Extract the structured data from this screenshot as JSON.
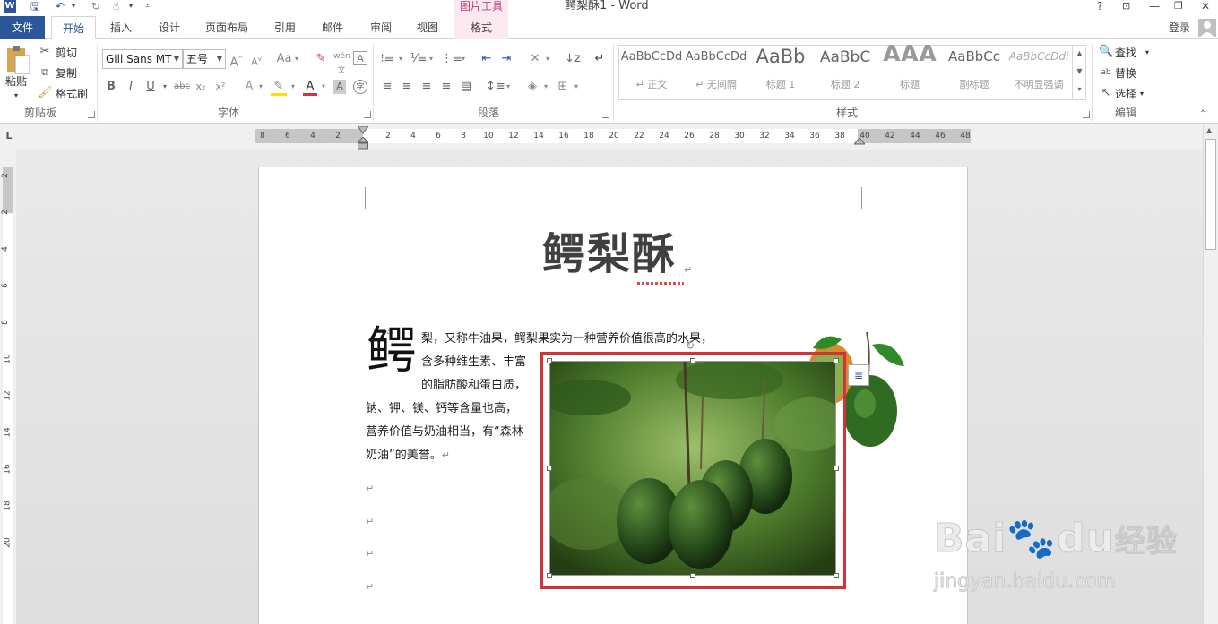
{
  "window": {
    "title": "鳄梨酥1 - Word",
    "help": "?",
    "login": "登录"
  },
  "picture_tools": {
    "label": "图片工具",
    "tab": "格式"
  },
  "tabs": [
    {
      "label": "文件"
    },
    {
      "label": "开始"
    },
    {
      "label": "插入"
    },
    {
      "label": "设计"
    },
    {
      "label": "页面布局"
    },
    {
      "label": "引用"
    },
    {
      "label": "邮件"
    },
    {
      "label": "审阅"
    },
    {
      "label": "视图"
    }
  ],
  "clipboard": {
    "paste": "粘贴",
    "cut": "剪切",
    "copy": "复制",
    "format_painter": "格式刷",
    "group": "剪贴板"
  },
  "font": {
    "name": "Gill Sans MT",
    "size": "五号",
    "group": "字体",
    "change_case": "Aa",
    "phonetic": "wén",
    "bold": "B",
    "italic": "I",
    "underline": "U",
    "strike": "abc",
    "subscript": "x₂",
    "superscript": "x²",
    "grow": "A",
    "shrink": "A",
    "font_color": "A",
    "effects": "A",
    "char_shading": "A",
    "enclose": "字",
    "border": "A"
  },
  "paragraph": {
    "group": "段落"
  },
  "styles": {
    "group": "样式",
    "items": [
      {
        "preview": "AaBbCcDd",
        "name": "↵ 正文"
      },
      {
        "preview": "AaBbCcDd",
        "name": "↵ 无间隔"
      },
      {
        "preview": "AaBb",
        "name": "标题 1"
      },
      {
        "preview": "AaBbC",
        "name": "标题 2"
      },
      {
        "preview": "AAA",
        "name": "标题"
      },
      {
        "preview": "AaBbCc",
        "name": "副标题"
      },
      {
        "preview": "AaBbCcDdi",
        "name": "不明显强调"
      }
    ]
  },
  "editing": {
    "group": "编辑",
    "find": "查找",
    "replace": "替换",
    "select": "选择"
  },
  "ruler": {
    "corner": "L",
    "left_ticks": [
      "8",
      "6",
      "4",
      "2"
    ],
    "ticks": [
      "2",
      "4",
      "6",
      "8",
      "10",
      "12",
      "14",
      "16",
      "18",
      "20",
      "22",
      "24",
      "26",
      "28",
      "30",
      "32",
      "34",
      "36",
      "38",
      "40",
      "42",
      "44",
      "46",
      "48"
    ],
    "vticks": [
      "2",
      "2",
      "4",
      "6",
      "8",
      "10",
      "12",
      "14",
      "16",
      "18",
      "20"
    ]
  },
  "document": {
    "title": "鳄梨酥",
    "dropcap": "鳄",
    "lines": [
      "梨，又称牛油果，鳄梨果实为一种营养价值很高的水果，",
      "含多种维生素、丰富",
      "的脂肪酸和蛋白质，",
      "钠、钾、镁、钙等含量也高，",
      "营养价值与奶油相当，有“森林",
      "奶油”的美誉。"
    ],
    "return_mark": "↵"
  },
  "watermark": {
    "brand": "Bai",
    "brand2": "du",
    "cn": "经验",
    "url": "jingyan.baidu.com"
  },
  "colors": {
    "accent": "#2b579a",
    "picture_tools": "#c43e7f",
    "selection": "#d13438"
  }
}
